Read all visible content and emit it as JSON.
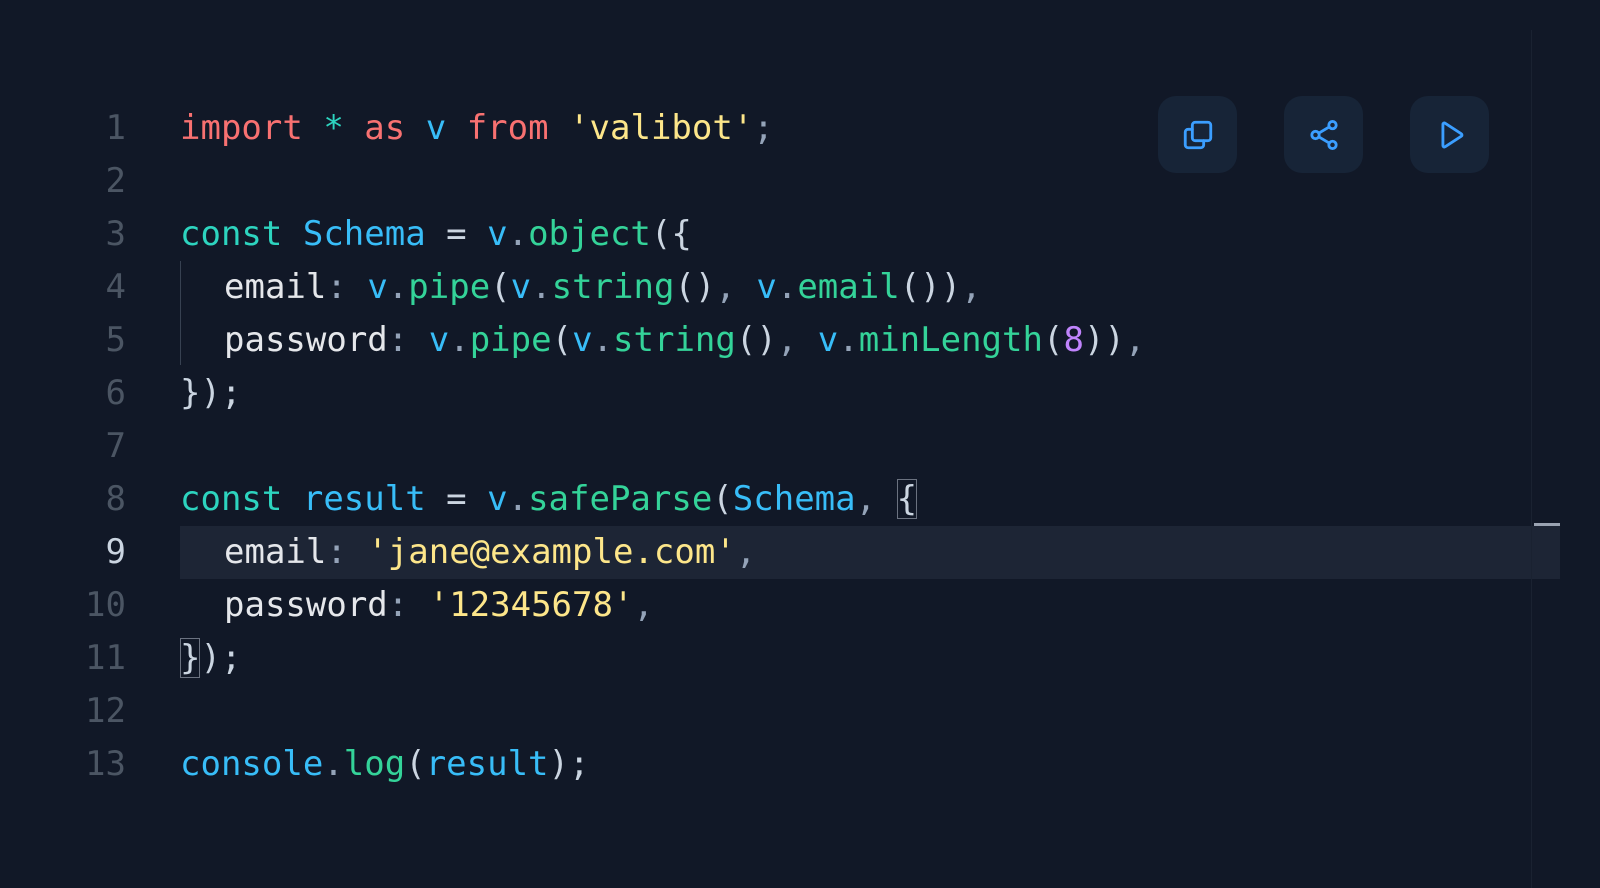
{
  "toolbar": {
    "buttons": [
      {
        "name": "copy",
        "icon": "copy-icon"
      },
      {
        "name": "share",
        "icon": "share-icon"
      },
      {
        "name": "run",
        "icon": "play-icon"
      }
    ],
    "icon_color": "#3b9eff"
  },
  "editor": {
    "active_line": 9,
    "line_numbers": [
      "1",
      "2",
      "3",
      "4",
      "5",
      "6",
      "7",
      "8",
      "9",
      "10",
      "11",
      "12",
      "13"
    ],
    "lines": [
      {
        "tokens": [
          {
            "t": "import",
            "c": "kw-red"
          },
          {
            "t": " ",
            "c": "punc"
          },
          {
            "t": "*",
            "c": "kw-teal"
          },
          {
            "t": " ",
            "c": "punc"
          },
          {
            "t": "as",
            "c": "kw-red"
          },
          {
            "t": " ",
            "c": "punc"
          },
          {
            "t": "v",
            "c": "ident"
          },
          {
            "t": " ",
            "c": "punc"
          },
          {
            "t": "from",
            "c": "kw-red"
          },
          {
            "t": " ",
            "c": "punc"
          },
          {
            "t": "'valibot'",
            "c": "str"
          },
          {
            "t": ";",
            "c": "dim"
          }
        ]
      },
      {
        "tokens": []
      },
      {
        "tokens": [
          {
            "t": "const",
            "c": "kw-teal"
          },
          {
            "t": " ",
            "c": "punc"
          },
          {
            "t": "Schema",
            "c": "ident"
          },
          {
            "t": " = ",
            "c": "punc"
          },
          {
            "t": "v",
            "c": "ident"
          },
          {
            "t": ".",
            "c": "dim"
          },
          {
            "t": "object",
            "c": "fn"
          },
          {
            "t": "({",
            "c": "punc"
          }
        ]
      },
      {
        "indent": 1,
        "tokens": [
          {
            "t": "email",
            "c": "prop"
          },
          {
            "t": ": ",
            "c": "dim"
          },
          {
            "t": "v",
            "c": "ident"
          },
          {
            "t": ".",
            "c": "dim"
          },
          {
            "t": "pipe",
            "c": "fn"
          },
          {
            "t": "(",
            "c": "punc"
          },
          {
            "t": "v",
            "c": "ident"
          },
          {
            "t": ".",
            "c": "dim"
          },
          {
            "t": "string",
            "c": "fn"
          },
          {
            "t": "()",
            "c": "punc"
          },
          {
            "t": ", ",
            "c": "dim"
          },
          {
            "t": "v",
            "c": "ident"
          },
          {
            "t": ".",
            "c": "dim"
          },
          {
            "t": "email",
            "c": "fn"
          },
          {
            "t": "())",
            "c": "punc"
          },
          {
            "t": ",",
            "c": "dim"
          }
        ]
      },
      {
        "indent": 1,
        "tokens": [
          {
            "t": "password",
            "c": "prop"
          },
          {
            "t": ": ",
            "c": "dim"
          },
          {
            "t": "v",
            "c": "ident"
          },
          {
            "t": ".",
            "c": "dim"
          },
          {
            "t": "pipe",
            "c": "fn"
          },
          {
            "t": "(",
            "c": "punc"
          },
          {
            "t": "v",
            "c": "ident"
          },
          {
            "t": ".",
            "c": "dim"
          },
          {
            "t": "string",
            "c": "fn"
          },
          {
            "t": "()",
            "c": "punc"
          },
          {
            "t": ", ",
            "c": "dim"
          },
          {
            "t": "v",
            "c": "ident"
          },
          {
            "t": ".",
            "c": "dim"
          },
          {
            "t": "minLength",
            "c": "fn"
          },
          {
            "t": "(",
            "c": "punc"
          },
          {
            "t": "8",
            "c": "num"
          },
          {
            "t": "))",
            "c": "punc"
          },
          {
            "t": ",",
            "c": "dim"
          }
        ]
      },
      {
        "tokens": [
          {
            "t": "});",
            "c": "punc"
          }
        ]
      },
      {
        "tokens": []
      },
      {
        "tokens": [
          {
            "t": "const",
            "c": "kw-teal"
          },
          {
            "t": " ",
            "c": "punc"
          },
          {
            "t": "result",
            "c": "ident"
          },
          {
            "t": " = ",
            "c": "punc"
          },
          {
            "t": "v",
            "c": "ident"
          },
          {
            "t": ".",
            "c": "dim"
          },
          {
            "t": "safeParse",
            "c": "fn"
          },
          {
            "t": "(",
            "c": "punc"
          },
          {
            "t": "Schema",
            "c": "ident"
          },
          {
            "t": ", ",
            "c": "dim"
          },
          {
            "t": "{",
            "c": "punc",
            "box": true
          }
        ]
      },
      {
        "indent": 1,
        "tokens": [
          {
            "t": "email",
            "c": "prop"
          },
          {
            "t": ": ",
            "c": "dim"
          },
          {
            "t": "'jane@example.com'",
            "c": "str"
          },
          {
            "t": ",",
            "c": "dim"
          }
        ]
      },
      {
        "indent": 1,
        "tokens": [
          {
            "t": "password",
            "c": "prop"
          },
          {
            "t": ": ",
            "c": "dim"
          },
          {
            "t": "'12345678'",
            "c": "str"
          },
          {
            "t": ",",
            "c": "dim"
          }
        ]
      },
      {
        "tokens": [
          {
            "t": "}",
            "c": "punc",
            "box": true
          },
          {
            "t": ");",
            "c": "punc"
          }
        ]
      },
      {
        "tokens": []
      },
      {
        "tokens": [
          {
            "t": "console",
            "c": "ident"
          },
          {
            "t": ".",
            "c": "dim"
          },
          {
            "t": "log",
            "c": "fn"
          },
          {
            "t": "(",
            "c": "punc"
          },
          {
            "t": "result",
            "c": "ident"
          },
          {
            "t": ");",
            "c": "punc"
          }
        ]
      }
    ]
  }
}
